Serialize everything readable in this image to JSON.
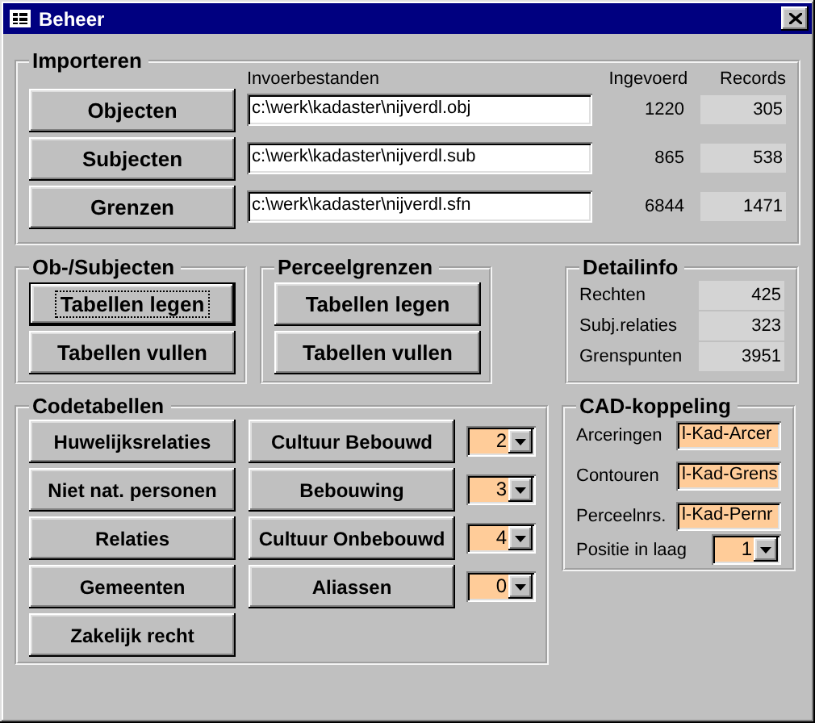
{
  "window": {
    "title": "Beheer"
  },
  "import": {
    "title": "Importeren",
    "columns": [
      "Invoerbestanden",
      "Ingevoerd",
      "Records"
    ],
    "rows": [
      {
        "button": "Objecten",
        "file": "c:\\werk\\kadaster\\nijverdl.obj",
        "entered": "1220",
        "records": "305"
      },
      {
        "button": "Subjecten",
        "file": "c:\\werk\\kadaster\\nijverdl.sub",
        "entered": "865",
        "records": "538"
      },
      {
        "button": "Grenzen",
        "file": "c:\\werk\\kadaster\\nijverdl.sfn",
        "entered": "6844",
        "records": "1471"
      }
    ]
  },
  "groups": [
    {
      "title": "Ob-/Subjecten",
      "buttons": [
        {
          "label": "Tabellen legen",
          "focused": true
        },
        {
          "label": "Tabellen vullen",
          "focused": false
        }
      ]
    },
    {
      "title": "Perceelgrenzen",
      "buttons": [
        {
          "label": "Tabellen legen",
          "focused": false
        },
        {
          "label": "Tabellen vullen",
          "focused": false
        }
      ]
    }
  ],
  "detailinfo": {
    "title": "Detailinfo",
    "rows": [
      {
        "label": "Rechten",
        "value": "425"
      },
      {
        "label": "Subj.relaties",
        "value": "323"
      },
      {
        "label": "Grenspunten",
        "value": "3951"
      }
    ]
  },
  "codetabellen": {
    "title": "Codetabellen",
    "buttons": [
      "Huwelijksrelaties",
      "Niet nat. personen",
      "Relaties",
      "Gemeenten",
      "Zakelijk recht"
    ],
    "combos": [
      {
        "label": "Cultuur Bebouwd",
        "value": "2"
      },
      {
        "label": "Bebouwing",
        "value": "3"
      },
      {
        "label": "Cultuur Onbebouwd",
        "value": "4"
      },
      {
        "label": "Aliassen",
        "value": "0"
      }
    ]
  },
  "cad": {
    "title": "CAD-koppeling",
    "fields": [
      {
        "label": "Arceringen",
        "value": "l-Kad-Arcer"
      },
      {
        "label": "Contouren",
        "value": "l-Kad-Grens"
      },
      {
        "label": "Perceelnrs.",
        "value": "l-Kad-Pernr"
      }
    ],
    "position": {
      "label": "Positie in laag",
      "value": "1"
    }
  }
}
